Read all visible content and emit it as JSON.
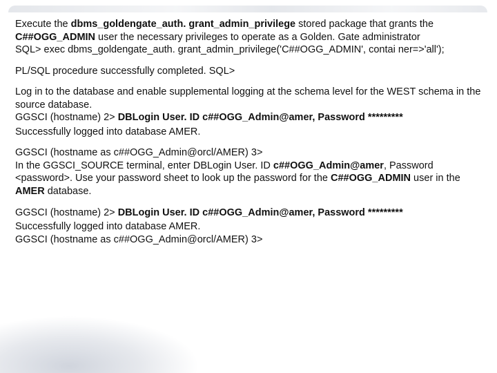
{
  "p1_a": "Execute the ",
  "p1_b": "dbms_goldengate_auth. grant_admin_privilege",
  "p1_c": " stored package that grants the ",
  "p1_d": "C##OGG_ADMIN",
  "p1_e": " user the necessary privileges to operate as a Golden. Gate administrator",
  "p1_f": "SQL> exec dbms_goldengate_auth. grant_admin_privilege('C##OGG_ADMIN', contai ner=>'all');",
  "p2": "PL/SQL procedure successfully completed. SQL>",
  "p3_a": "Log in to the database and enable supplemental logging at the schema level for the WEST schema in the source database.",
  "p3_b1": "GGSCI (hostname) 2> ",
  "p3_b2": "DBLogin User. ID c##OGG_Admin@amer, Password *********",
  "p4": "Successfully logged into database AMER.",
  "p5_a": "GGSCI (hostname as c##OGG_Admin@orcl/AMER) 3>",
  "p5_b1": "In the GGSCI_SOURCE terminal, enter DBLogin User. ID ",
  "p5_b2": "c##OGG_Admin@amer",
  "p5_b3": ", Password <password>. Use your password sheet to look up the password for the ",
  "p5_b4": "C##OGG_ADMIN",
  "p5_b5": " user in the ",
  "p5_b6": "AMER",
  "p5_b7": " database.",
  "p6_a1": "GGSCI (hostname) 2> ",
  "p6_a2": "DBLogin User. ID c##OGG_Admin@amer, Password *********",
  "p7_a": "Successfully logged into database AMER.",
  "p7_b": "GGSCI (hostname as c##OGG_Admin@orcl/AMER) 3>"
}
